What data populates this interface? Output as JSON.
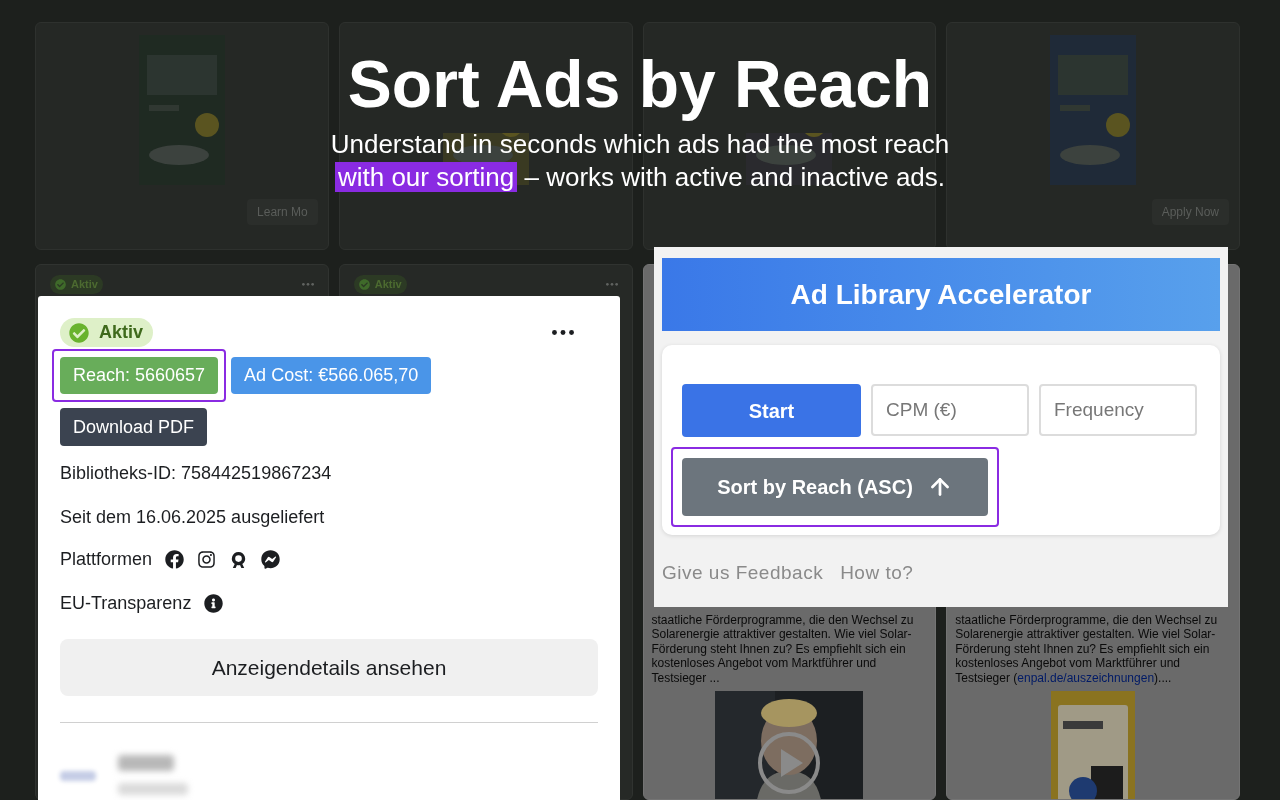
{
  "headline": "Sort Ads by Reach",
  "subtitle": {
    "line_1": "Understand in seconds which ads had the most reach",
    "highlight": "with our sorting",
    "rest": "– works with active and inactive ads."
  },
  "background_cards": [
    {
      "kind": "picture",
      "button": "Learn Mo"
    },
    {
      "kind": "picture"
    },
    {
      "kind": "picture"
    },
    {
      "kind": "picture",
      "button": "Apply Now"
    }
  ],
  "background_row_2": [
    {
      "status": "Aktiv"
    },
    {
      "status": "Aktiv"
    },
    {
      "text": "staatliche Förderprogramme, die den Wechsel zu Solarenergie attraktiver gestalten. Wie viel Solar-Förderung steht Ihnen zu? Es empfiehlt sich ein kostenloses Angebot vom Marktführer und Testsieger ...",
      "kind": "video"
    },
    {
      "text": "staatliche Förderprogramme, die den Wechsel zu Solarenergie attraktiver gestalten. Wie viel Solar-Förderung steht Ihnen zu? Es empfiehlt sich ein kostenloses Angebot vom Marktführer und Testsieger (",
      "link": "enpal.de/auszeichnungen",
      "text_end": ")...."
    }
  ],
  "ad_card": {
    "status": "Aktiv",
    "reach": {
      "label": "Reach: 5660657",
      "highlighted": true
    },
    "ad_cost": {
      "label": "Ad Cost: €566.065,70"
    },
    "download": "Download PDF",
    "library_id": "Bibliotheks-ID: 758442519867234",
    "since": "Seit dem 16.06.2025 ausgeliefert",
    "platforms_label": "Plattformen",
    "platforms": [
      {
        "kind": "facebook"
      },
      {
        "kind": "instagram"
      },
      {
        "kind": "audience_network"
      },
      {
        "kind": "messenger"
      }
    ],
    "eu_label": "EU-Transparenz",
    "details_button": "Anzeigendetails ansehen"
  },
  "extension_panel": {
    "title": "Ad Library Accelerator",
    "start_button": "Start",
    "cpm_field": {
      "placeholder": "CPM (€)"
    },
    "frequency_field": {
      "placeholder": "Frequency"
    },
    "sort_button": {
      "label": "Sort by Reach (ASC)",
      "highlighted": true
    },
    "links": [
      "Give us Feedback",
      "How to?"
    ]
  }
}
